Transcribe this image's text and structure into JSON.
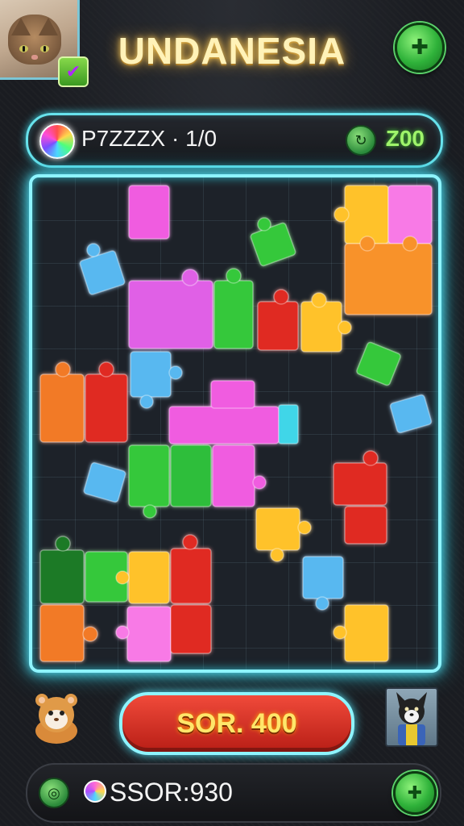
{
  "header": {
    "title": "UNDANESIA",
    "avatar_icon": "cat-avatar",
    "badge_icon": "check-icon",
    "right_button_icon": "puzzle-icon"
  },
  "status_bar": {
    "label": "P7ZZZX · 1/0",
    "orb_icon": "rainbow-orb-icon",
    "currency_icon": "green-coin-icon",
    "currency_value": "Z00"
  },
  "board": {
    "colors": {
      "pink": "#f05ce0",
      "green": "#34c83a",
      "red": "#e02a22",
      "orange": "#f27a28",
      "yellow": "#ffc22a",
      "blue": "#58b8f0",
      "cyan": "#3fd6e8",
      "darkgreen": "#1f7a28"
    }
  },
  "footer": {
    "score_label": "SOR. 400",
    "mascot_icon": "hamster-mascot-icon",
    "dog_icon": "dog-character-icon",
    "bottom_icon_left": "swirl-icon",
    "gem_icon": "candy-gem-icon",
    "bottom_score": "SSOR:930",
    "bottom_button_icon": "puzzle-icon"
  }
}
